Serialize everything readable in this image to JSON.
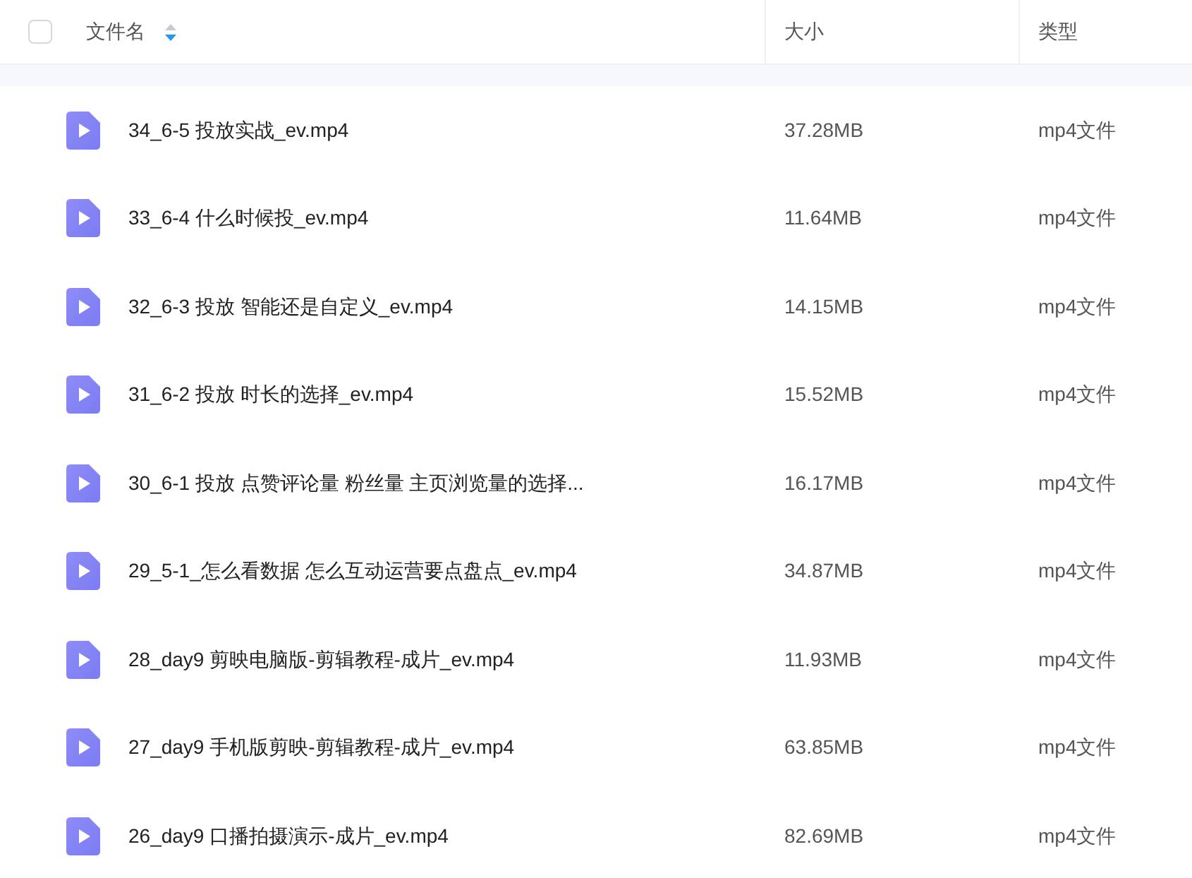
{
  "header": {
    "select_all": {
      "checked": false
    },
    "columns": [
      {
        "label": "文件名",
        "sort_descending": true
      },
      {
        "label": "大小"
      },
      {
        "label": "类型"
      }
    ]
  },
  "rows": [
    {
      "name": "34_6-5 投放实战_ev.mp4",
      "size": "37.28MB",
      "type": "mp4文件"
    },
    {
      "name": "33_6-4 什么时候投_ev.mp4",
      "size": "11.64MB",
      "type": "mp4文件"
    },
    {
      "name": "32_6-3 投放 智能还是自定义_ev.mp4",
      "size": "14.15MB",
      "type": "mp4文件"
    },
    {
      "name": "31_6-2 投放 时长的选择_ev.mp4",
      "size": "15.52MB",
      "type": "mp4文件"
    },
    {
      "name": "30_6-1 投放 点赞评论量 粉丝量 主页浏览量的选择...",
      "size": "16.17MB",
      "type": "mp4文件"
    },
    {
      "name": "29_5-1_怎么看数据 怎么互动运营要点盘点_ev.mp4",
      "size": "34.87MB",
      "type": "mp4文件"
    },
    {
      "name": "28_day9 剪映电脑版-剪辑教程-成片_ev.mp4",
      "size": "11.93MB",
      "type": "mp4文件"
    },
    {
      "name": "27_day9 手机版剪映-剪辑教程-成片_ev.mp4",
      "size": "63.85MB",
      "type": "mp4文件"
    },
    {
      "name": "26_day9 口播拍摄演示-成片_ev.mp4",
      "size": "82.69MB",
      "type": "mp4文件"
    }
  ]
}
